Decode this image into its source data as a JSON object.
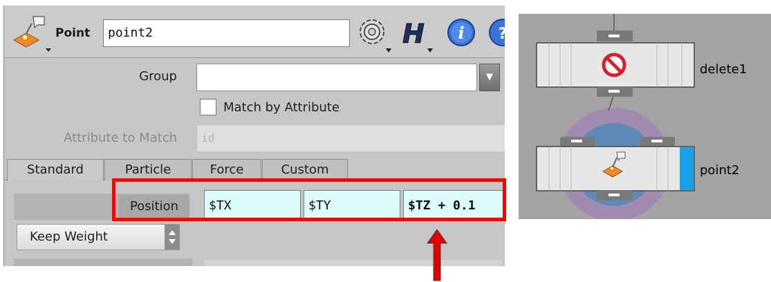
{
  "panel": {
    "node_type": "Point",
    "node_name": "point2",
    "group": {
      "label": "Group",
      "value": ""
    },
    "match_by_attribute": {
      "label": "Match by Attribute",
      "checked": false
    },
    "attribute_to_match": {
      "label": "Attribute to Match",
      "value": "id"
    },
    "tabs": [
      "Standard",
      "Particle",
      "Force",
      "Custom"
    ],
    "active_tab": "Standard",
    "position": {
      "label": "Position",
      "x": "$TX",
      "y": "$TY",
      "z": "$TZ + 0.1"
    },
    "keep_weight": "Keep Weight",
    "highlight_color": "#ff0000",
    "vector_field_color": "#dcfbfb"
  },
  "header_icons": [
    "point-sop-icon",
    "gear-icon",
    "houdini-h-icon",
    "info-icon",
    "help-icon"
  ],
  "network": {
    "nodes": [
      {
        "name": "delete1",
        "icon": "bypass-icon"
      },
      {
        "name": "point2",
        "icon": "point-sop-icon",
        "display_flag": true
      }
    ],
    "display_flag_color": "#1aa0e6"
  }
}
